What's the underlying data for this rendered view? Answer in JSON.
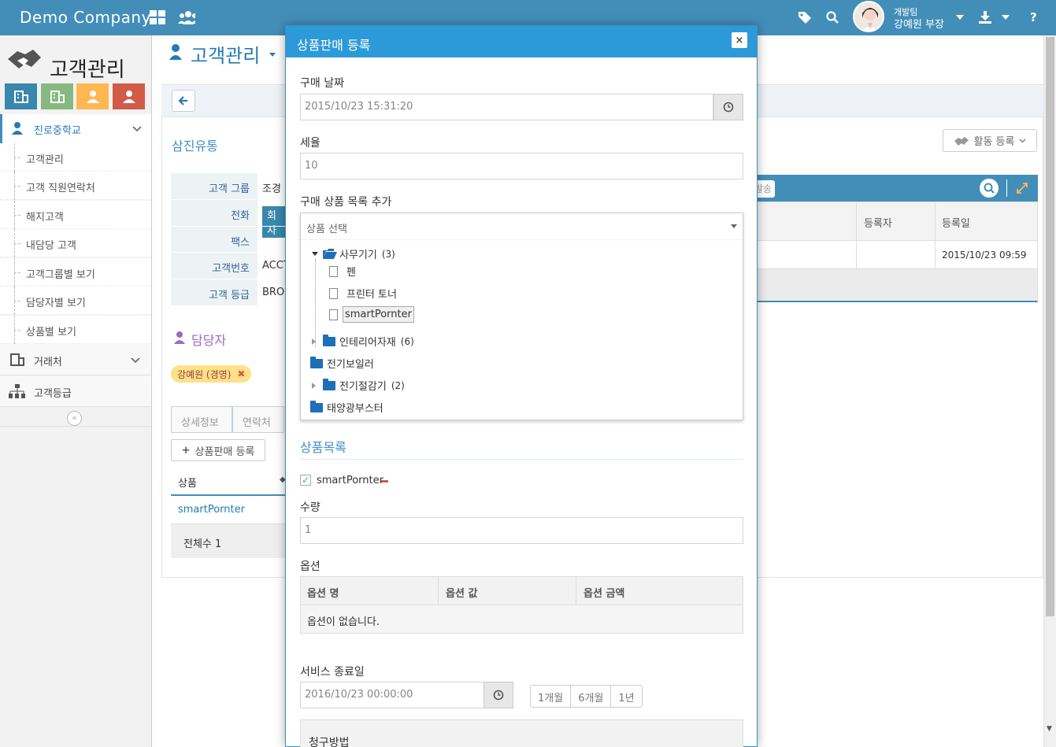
{
  "topbar": {
    "brand": "Demo Company",
    "user_team": "개발팀",
    "user_name": "강예원 부장",
    "help": "?"
  },
  "sidebar": {
    "logo_text": "고객관리",
    "active_menu": "진로중학교",
    "items": [
      {
        "label": "고객관리"
      },
      {
        "label": "고객 직원연락처"
      },
      {
        "label": "해지고객"
      },
      {
        "label": "내담당 고객"
      },
      {
        "label": "고객그룹별 보기"
      },
      {
        "label": "담당자별 보기"
      },
      {
        "label": "상품별 보기"
      }
    ],
    "menu_trade": "거래처",
    "menu_grade": "고객등급",
    "collapse": "«"
  },
  "page": {
    "title": "고객관리",
    "company": "삼진유통",
    "info_rows": [
      {
        "key": "고객 그룹",
        "value": "조경"
      },
      {
        "key": "전화",
        "value": "회사"
      },
      {
        "key": "팩스",
        "value": ""
      },
      {
        "key": "고객번호",
        "value": "ACCT"
      },
      {
        "key": "고객 등급",
        "value": "BRO"
      }
    ],
    "manager_title": "담당자",
    "manager_chip": "강예원 (경영)",
    "tabs": [
      "상세정보",
      "연락처"
    ],
    "sales_button": "상품판매 등록",
    "product_col": "상품",
    "product_cell": "smartPornter",
    "total": "전체수 1"
  },
  "right_panel": {
    "activity_button": "활동 등록",
    "partial_btn": "발송",
    "col_registrant": "등록자",
    "col_date": "등록일",
    "row_date": "2015/10/23 09:59"
  },
  "modal": {
    "title": "상품판매 등록",
    "close": "×",
    "purchase_date_label": "구매 날짜",
    "purchase_date_value": "2015/10/23 15:31:20",
    "tax_label": "세율",
    "tax_value": "10",
    "add_products_label": "구매 상품 목록 추가",
    "select_placeholder": "상품 선택",
    "tree": {
      "office": "사무기기",
      "office_count": "(3)",
      "pen": "펜",
      "toner": "프린터 토너",
      "smart": "smartPornter",
      "interior": "인테리어자재",
      "interior_count": "(6)",
      "boiler": "전기보일러",
      "saver": "전기절감기",
      "saver_count": "(2)",
      "solar": "태양광부스터"
    },
    "product_list_title": "상품목록",
    "selected_product": "smartPornter",
    "qty_label": "수량",
    "qty_value": "1",
    "option_label": "옵션",
    "option_cols": [
      "옵션 명",
      "옵션 값",
      "옵션 금액"
    ],
    "option_empty": "옵션이 없습니다.",
    "service_end_label": "서비스 종료일",
    "service_end_value": "2016/10/23 00:00:00",
    "periods": [
      "1개월",
      "6개월",
      "1년"
    ],
    "billing_label": "청구방법"
  }
}
